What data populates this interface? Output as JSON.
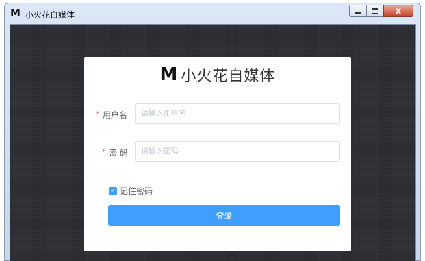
{
  "window": {
    "logo": "M",
    "title": "小火花自媒体",
    "controls": {
      "close": "x"
    }
  },
  "card": {
    "logo": "M",
    "title": "小火花自媒体"
  },
  "form": {
    "username": {
      "required_mark": "*",
      "label": "用户名",
      "placeholder": "请输入用户名"
    },
    "password": {
      "required_mark": "*",
      "label": "密 码",
      "placeholder": "请输入密码"
    },
    "remember": {
      "label": "记住密码",
      "checked": true
    },
    "submit_label": "登录"
  },
  "colors": {
    "accent": "#409eff",
    "required": "#f56c6c",
    "background": "#2b2d33"
  }
}
